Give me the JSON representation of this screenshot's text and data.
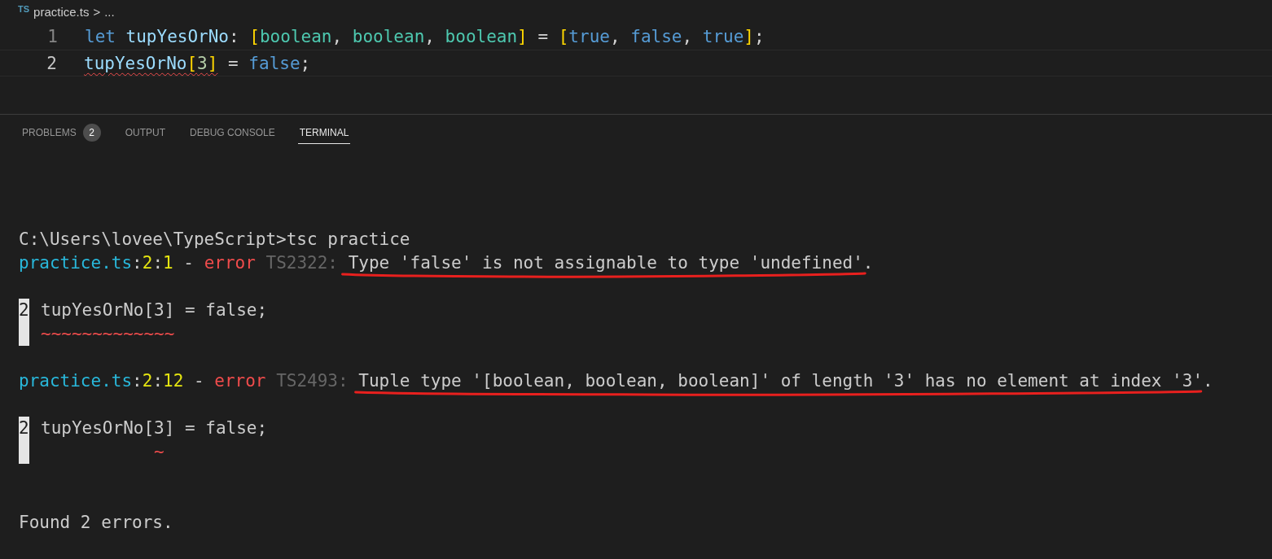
{
  "breadcrumb": {
    "file_badge": "TS",
    "file": "practice.ts",
    "separator": ">",
    "more": "..."
  },
  "editor": {
    "lines": [
      {
        "number": "1",
        "current": false,
        "parts": [
          {
            "error": false,
            "tokens": [
              {
                "text": "let ",
                "kind": "keyword"
              },
              {
                "text": "tupYesOrNo",
                "kind": "variable"
              },
              {
                "text": ": ",
                "kind": "punct"
              },
              {
                "text": "[",
                "kind": "bracket"
              },
              {
                "text": "boolean",
                "kind": "type"
              },
              {
                "text": ", ",
                "kind": "punct"
              },
              {
                "text": "boolean",
                "kind": "type"
              },
              {
                "text": ", ",
                "kind": "punct"
              },
              {
                "text": "boolean",
                "kind": "type"
              },
              {
                "text": "]",
                "kind": "bracket"
              },
              {
                "text": " = ",
                "kind": "punct"
              },
              {
                "text": "[",
                "kind": "bracket"
              },
              {
                "text": "true",
                "kind": "keyword"
              },
              {
                "text": ", ",
                "kind": "punct"
              },
              {
                "text": "false",
                "kind": "keyword"
              },
              {
                "text": ", ",
                "kind": "punct"
              },
              {
                "text": "true",
                "kind": "keyword"
              },
              {
                "text": "]",
                "kind": "bracket"
              },
              {
                "text": ";",
                "kind": "punct"
              }
            ]
          }
        ]
      },
      {
        "number": "2",
        "current": true,
        "parts": [
          {
            "error": true,
            "tokens": [
              {
                "text": "tupYesOrNo",
                "kind": "variable"
              },
              {
                "text": "[",
                "kind": "bracket"
              },
              {
                "text": "3",
                "kind": "number"
              },
              {
                "text": "]",
                "kind": "bracket"
              }
            ]
          },
          {
            "error": false,
            "tokens": [
              {
                "text": " = ",
                "kind": "punct"
              },
              {
                "text": "false",
                "kind": "keyword"
              },
              {
                "text": ";",
                "kind": "punct"
              }
            ]
          }
        ]
      }
    ]
  },
  "panel_tabs": [
    {
      "label": "PROBLEMS",
      "badge": "2",
      "selected": false
    },
    {
      "label": "OUTPUT",
      "selected": false
    },
    {
      "label": "DEBUG CONSOLE",
      "selected": false
    },
    {
      "label": "TERMINAL",
      "selected": true
    }
  ],
  "terminal": {
    "lines": [
      {
        "kind": "text",
        "segments": [
          {
            "text": "C:\\Users\\lovee\\TypeScript>tsc practice",
            "kind": "plain",
            "hand_underline": false
          }
        ]
      },
      {
        "kind": "text",
        "segments": [
          {
            "text": "practice.ts",
            "kind": "path",
            "hand_underline": false
          },
          {
            "text": ":",
            "kind": "plain",
            "hand_underline": false
          },
          {
            "text": "2",
            "kind": "position",
            "hand_underline": false
          },
          {
            "text": ":",
            "kind": "plain",
            "hand_underline": false
          },
          {
            "text": "1",
            "kind": "position",
            "hand_underline": false
          },
          {
            "text": " - ",
            "kind": "plain",
            "hand_underline": false
          },
          {
            "text": "error",
            "kind": "error",
            "hand_underline": false
          },
          {
            "text": " TS2322: ",
            "kind": "code",
            "hand_underline": false
          },
          {
            "text": "Type 'false' is not assignable to type 'undefined'.",
            "kind": "plain",
            "hand_underline": true
          }
        ]
      },
      {
        "kind": "blank"
      },
      {
        "kind": "snippet",
        "line_number": "2",
        "code": "tupYesOrNo[3] = false;",
        "squiggle": "~~~~~~~~~~~~~"
      },
      {
        "kind": "blank"
      },
      {
        "kind": "text",
        "segments": [
          {
            "text": "practice.ts",
            "kind": "path",
            "hand_underline": false
          },
          {
            "text": ":",
            "kind": "plain",
            "hand_underline": false
          },
          {
            "text": "2",
            "kind": "position",
            "hand_underline": false
          },
          {
            "text": ":",
            "kind": "plain",
            "hand_underline": false
          },
          {
            "text": "12",
            "kind": "position",
            "hand_underline": false
          },
          {
            "text": " - ",
            "kind": "plain",
            "hand_underline": false
          },
          {
            "text": "error",
            "kind": "error",
            "hand_underline": false
          },
          {
            "text": " TS2493: ",
            "kind": "code",
            "hand_underline": false
          },
          {
            "text": "Tuple type '[boolean, boolean, boolean]' of length '3' has no element at index '3'.",
            "kind": "plain",
            "hand_underline": true
          }
        ]
      },
      {
        "kind": "blank"
      },
      {
        "kind": "snippet",
        "line_number": "2",
        "code": "tupYesOrNo[3] = false;",
        "squiggle": "           ~"
      },
      {
        "kind": "blank"
      },
      {
        "kind": "blank"
      },
      {
        "kind": "text",
        "segments": [
          {
            "text": "Found 2 errors.",
            "kind": "plain",
            "hand_underline": false
          }
        ]
      }
    ]
  }
}
